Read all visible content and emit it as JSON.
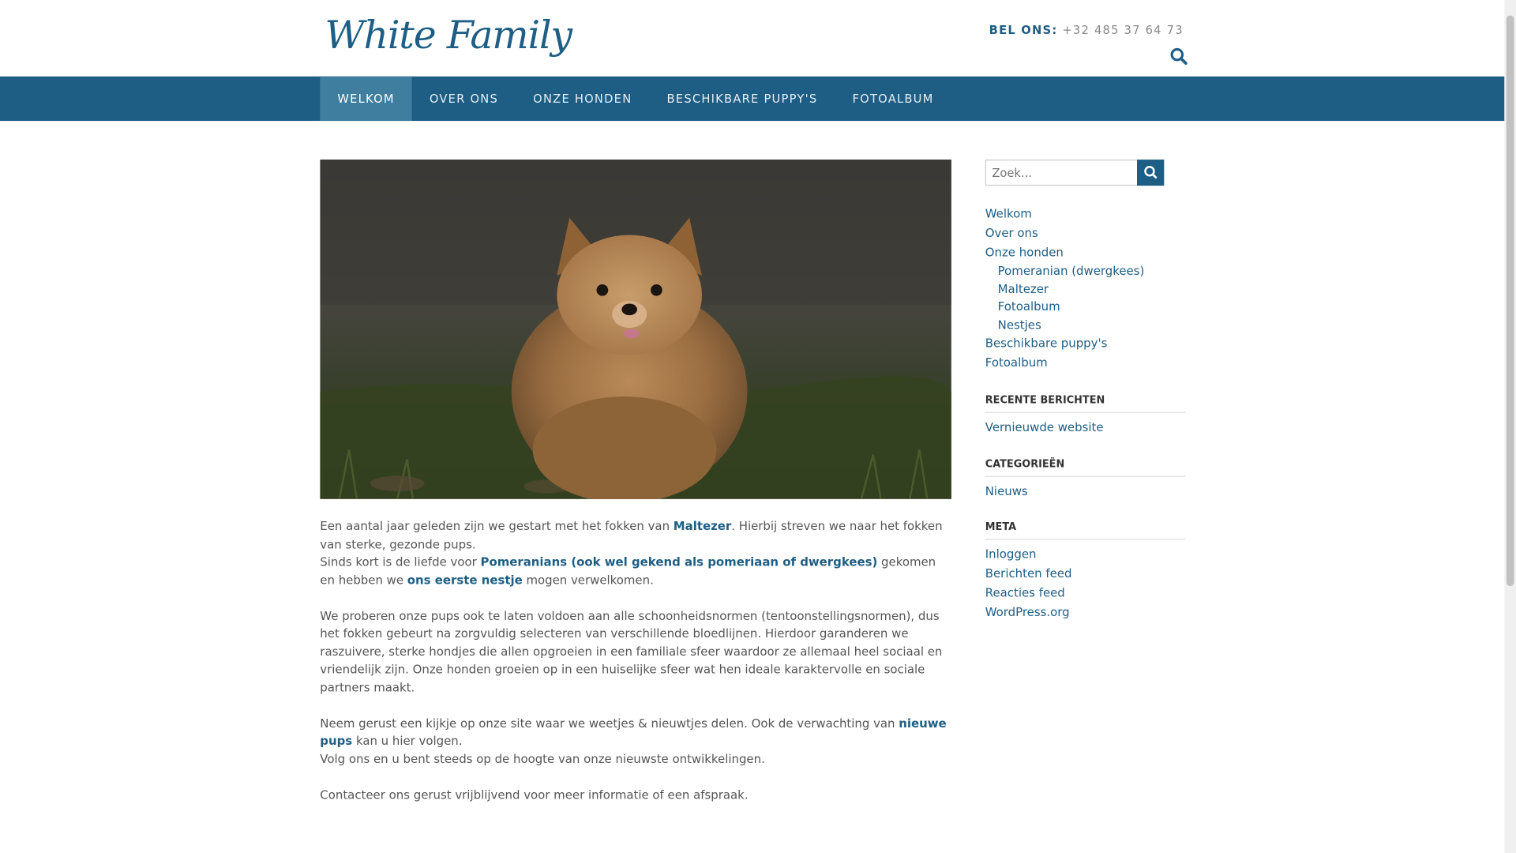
{
  "header": {
    "logo": "White Family",
    "phone_label": "BEL ONS:",
    "phone_number": "+32 485 37 64 73",
    "search_icon": "search-icon"
  },
  "nav": {
    "items": [
      {
        "label": "WELKOM",
        "active": true
      },
      {
        "label": "OVER ONS"
      },
      {
        "label": "ONZE HONDEN"
      },
      {
        "label": "BESCHIKBARE PUPPY'S"
      },
      {
        "label": "FOTOALBUM"
      }
    ]
  },
  "content": {
    "p1_a": "Een aantal jaar geleden zijn we gestart met het fokken van ",
    "p1_link": "Maltezer",
    "p1_b": ". Hierbij streven we naar het fokken van sterke, gezonde pups.",
    "p2_a": "Sinds kort is de liefde voor ",
    "p2_link1": "Pomeranians (ook wel gekend als pomeriaan of dwergkees)",
    "p2_b": " gekomen en hebben we ",
    "p2_link2": "ons eerste nestje",
    "p2_c": " mogen verwelkomen.",
    "p3": "We proberen onze pups ook te laten voldoen aan alle schoonheidsnormen (tentoonstellingsnormen), dus het fokken gebeurt na zorgvuldig selecteren van verschillende bloedlijnen. Hierdoor garanderen we raszuivere, sterke hondjes die allen opgroeien in een familiale sfeer waardoor ze allemaal heel sociaal en vriendelijk zijn. Onze honden groeien op in een huiselijke sfeer wat hen ideale karaktervolle en sociale partners maakt.",
    "p4_a": "Neem gerust een kijkje op onze site waar we weetjes & nieuwtjes delen. Ook de verwachting van ",
    "p4_link": "nieuwe pups",
    "p4_b": " kan u hier volgen.",
    "p5": "Volg ons en u bent steeds op de hoogte van onze nieuwste ontwikkelingen.",
    "p6": "Contacteer ons gerust vrijblijvend voor meer informatie of een afspraak."
  },
  "sidebar": {
    "search_placeholder": "Zoek...",
    "links": [
      {
        "label": "Welkom"
      },
      {
        "label": "Over ons"
      },
      {
        "label": "Onze honden"
      },
      {
        "label": "Pomeranian (dwergkees)",
        "sub": true
      },
      {
        "label": "Maltezer",
        "sub": true
      },
      {
        "label": "Fotoalbum",
        "sub": true
      },
      {
        "label": "Nestjes",
        "sub": true
      },
      {
        "label": "Beschikbare puppy's"
      },
      {
        "label": "Fotoalbum"
      }
    ],
    "recent_heading": "RECENTE BERICHTEN",
    "recent_items": [
      "Vernieuwde website"
    ],
    "categories_heading": "CATEGORIEËN",
    "categories_items": [
      "Nieuws"
    ],
    "meta_heading": "META",
    "meta_items": [
      "Inloggen",
      "Berichten feed",
      "Reacties feed",
      "WordPress.org"
    ]
  },
  "colors": {
    "brand": "#1e5e85",
    "nav_active": "#3f7e9e"
  }
}
